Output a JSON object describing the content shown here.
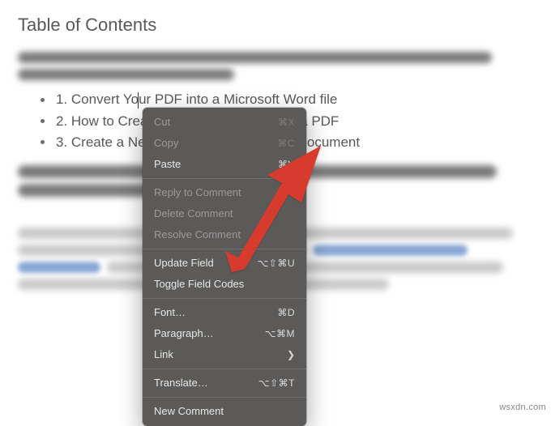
{
  "document": {
    "toc_title": "Table of Contents",
    "toc_items": [
      "1. Convert Your PDF into a Microsoft Word file",
      "2. How to Create a Table of Contents in a PDF",
      "3. Create a New PDF from the Existing Document"
    ]
  },
  "context_menu": {
    "cut": "Cut",
    "cut_shortcut": "⌘X",
    "copy": "Copy",
    "copy_shortcut": "⌘C",
    "paste": "Paste",
    "paste_shortcut": "⌘V",
    "reply_comment": "Reply to Comment",
    "delete_comment": "Delete Comment",
    "resolve_comment": "Resolve Comment",
    "update_field": "Update Field",
    "update_field_shortcut": "⌥⇧⌘U",
    "toggle_codes": "Toggle Field Codes",
    "font": "Font…",
    "font_shortcut": "⌘D",
    "paragraph": "Paragraph…",
    "paragraph_shortcut": "⌥⌘M",
    "link": "Link",
    "translate": "Translate…",
    "translate_shortcut": "⌥⇧⌘T",
    "new_comment": "New Comment"
  },
  "watermark": "wsxdn.com"
}
